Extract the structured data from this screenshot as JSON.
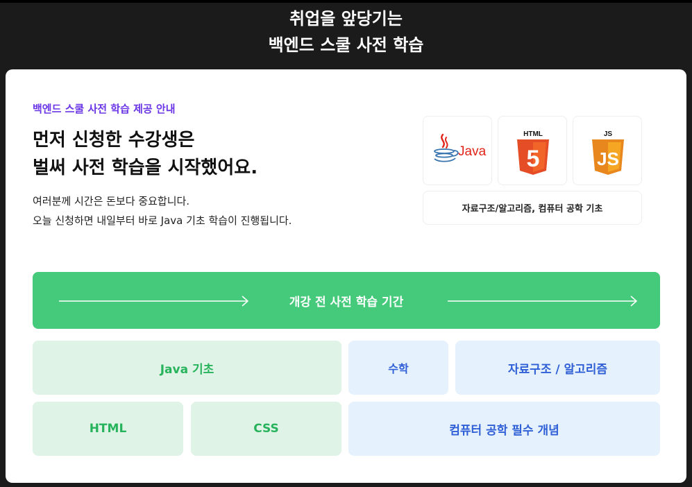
{
  "hero": {
    "line1": "취업을 앞당기는",
    "line2": "백엔드 스쿨 사전 학습"
  },
  "intro": {
    "eyebrow": "백엔드 스쿨 사전 학습 제공 안내",
    "headline_line1": "먼저 신청한 수강생은",
    "headline_line2": "벌써 사전 학습을 시작했어요.",
    "desc_line1": "여러분께 시간은 돈보다 중요합니다.",
    "desc_line2": "오늘 신청하면 내일부터 바로 Java 기초 학습이 진행됩니다."
  },
  "logos": {
    "java": {
      "icon": "java-logo-icon",
      "text": "Java",
      "color": "#e2231a",
      "accent": "#3a75b0"
    },
    "html": {
      "icon": "html5-logo-icon",
      "label": "HTML",
      "number": "5",
      "color": "#e44d26"
    },
    "js": {
      "icon": "js-logo-icon",
      "label": "JS",
      "letters": "JS",
      "color": "#f0931d"
    },
    "topics": "자료구조/알고리즘, 컴퓨터 공학 기초"
  },
  "period": {
    "label": "개강 전 사전 학습 기간",
    "color": "#45c97a"
  },
  "curriculum": {
    "java_basics": "Java 기초",
    "math": "수학",
    "data_structures": "자료구조 / 알고리즘",
    "html": "HTML",
    "css": "CSS",
    "cs_fundamentals": "컴퓨터 공학 필수 개념"
  }
}
